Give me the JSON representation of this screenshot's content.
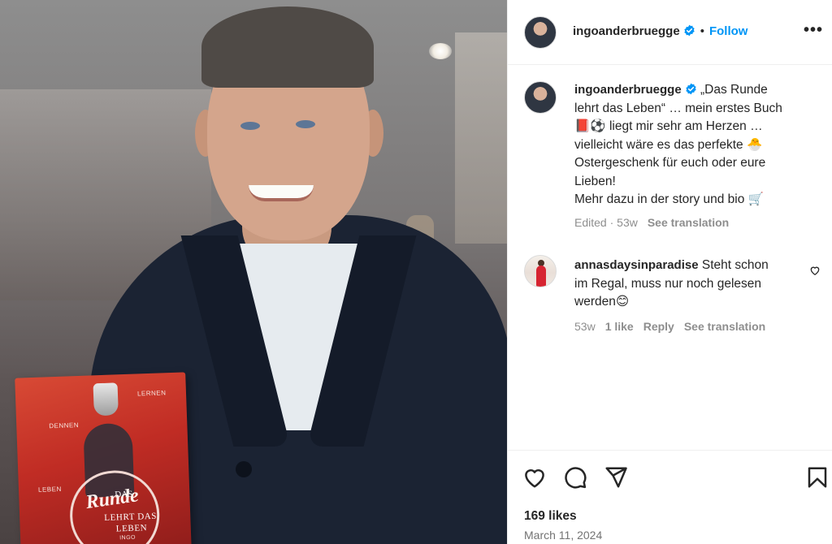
{
  "post": {
    "photo": {
      "book_cover": {
        "title_word_1": "DAS",
        "title_word_2": "Runde",
        "title_word_3": "LEHRT DAS",
        "title_word_4": "LEBEN",
        "side_word_left": "DENNEN",
        "side_word_right": "LERNEN",
        "side_word_low": "LEBEN",
        "author": "INGO"
      }
    }
  },
  "header": {
    "username": "ingoanderbruegge",
    "separator": "•",
    "follow_label": "Follow",
    "more_label": "•••",
    "verified_icon": "verified-badge-icon",
    "accent_color": "#0095f6"
  },
  "caption": {
    "username": "ingoanderbruegge",
    "lines": [
      "„Das Runde",
      "lehrt das Leben“ … mein erstes Buch",
      "liegt mir sehr am Herzen …",
      "vielleicht wäre es das perfekte",
      "Ostergeschenk für euch oder eure",
      "Lieben!",
      "Mehr dazu in der story und bio"
    ],
    "emoji_book": "📕",
    "emoji_ball": "⚽",
    "emoji_egg": "🐣",
    "emoji_cart": "🛒",
    "edited_label": "Edited",
    "time": "53w",
    "see_translation": "See translation"
  },
  "comment": {
    "username": "annasdaysinparadise",
    "lines": [
      "Steht schon",
      "im Regal, muss nur noch gelesen",
      "werden"
    ],
    "emoji_smile": "😊",
    "time": "53w",
    "likes_label": "1 like",
    "reply_label": "Reply",
    "see_translation": "See translation"
  },
  "actions": {
    "likes": "169 likes",
    "date": "March 11, 2024"
  }
}
